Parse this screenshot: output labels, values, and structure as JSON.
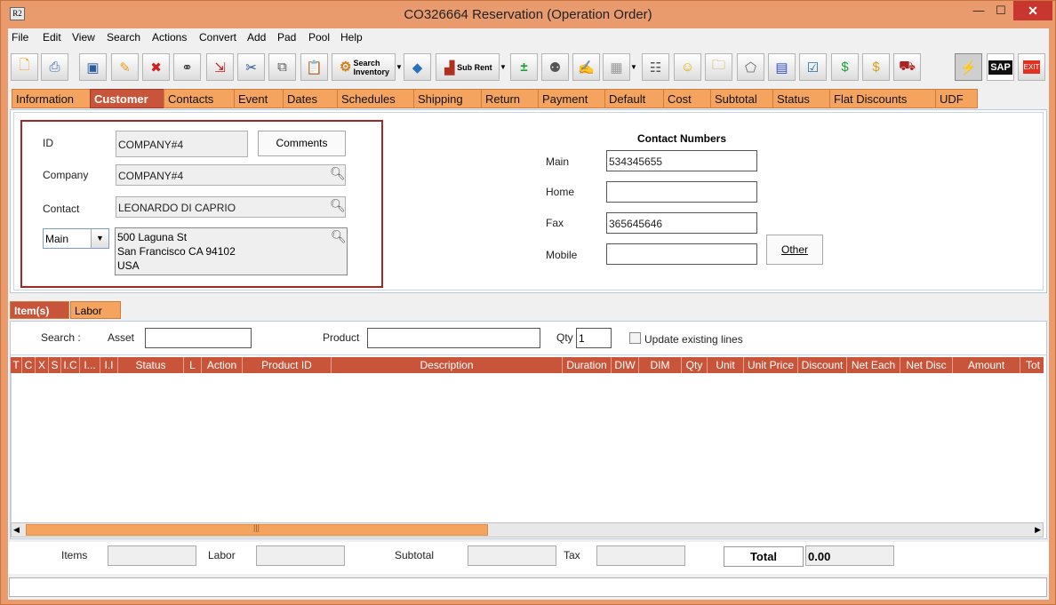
{
  "window": {
    "icon_text": "R2",
    "title": "CO326664 Reservation (Operation Order)",
    "minimize": "—",
    "maximize": "☐",
    "close": "✕"
  },
  "menu": [
    "File",
    "Edit",
    "View",
    "Search",
    "Actions",
    "Convert",
    "Add",
    "Pad",
    "Pool",
    "Help"
  ],
  "toolbar": {
    "search_inventory_line1": "Search",
    "search_inventory_line2": "Inventory",
    "sub_rent": "Sub Rent",
    "sap": "SAP",
    "exit": "EXIT"
  },
  "tabs": [
    "Information",
    "Customer",
    "Contacts",
    "Event",
    "Dates",
    "Schedules",
    "Shipping",
    "Return",
    "Payment",
    "Default",
    "Cost",
    "Subtotal",
    "Status",
    "Flat Discounts",
    "UDF"
  ],
  "active_tab": "Customer",
  "customer": {
    "id_label": "ID",
    "id_value": "COMPANY#4",
    "comments_button": "Comments",
    "company_label": "Company",
    "company_value": "COMPANY#4",
    "contact_label": "Contact",
    "contact_value": "LEONARDO DI CAPRIO",
    "address_type": "Main",
    "address_line1": "500 Laguna St",
    "address_line2": "San Francisco CA 94102",
    "address_line3": "USA"
  },
  "contact_numbers": {
    "title": "Contact Numbers",
    "main_label": "Main",
    "main_value": "534345655",
    "home_label": "Home",
    "home_value": "",
    "fax_label": "Fax",
    "fax_value": "365645646",
    "mobile_label": "Mobile",
    "mobile_value": "",
    "other_button": "Other"
  },
  "subtabs": [
    "Item(s)",
    "Labor"
  ],
  "search": {
    "label": "Search :",
    "asset_label": "Asset",
    "asset_value": "",
    "product_label": "Product",
    "product_value": "",
    "qty_label": "Qty",
    "qty_value": "1",
    "update_lines_label": "Update existing lines"
  },
  "grid_columns": [
    "T",
    "C",
    "X",
    "S",
    "I.C",
    "I...",
    "I.I",
    "Status",
    "L",
    "Action",
    "Product ID",
    "Description",
    "Duration",
    "DIW",
    "DIM",
    "Qty",
    "Unit",
    "Unit Price",
    "Discount",
    "Net Each",
    "Net Disc",
    "Amount",
    "Tot"
  ],
  "totals": {
    "items_label": "Items",
    "items_value": "",
    "labor_label": "Labor",
    "labor_value": "",
    "subtotal_label": "Subtotal",
    "subtotal_value": "",
    "tax_label": "Tax",
    "tax_value": "",
    "total_label": "Total",
    "total_value": "0.00"
  },
  "colors": {
    "accent": "#c8543a",
    "tab": "#f5a45f",
    "frame": "#ea9b6e"
  }
}
